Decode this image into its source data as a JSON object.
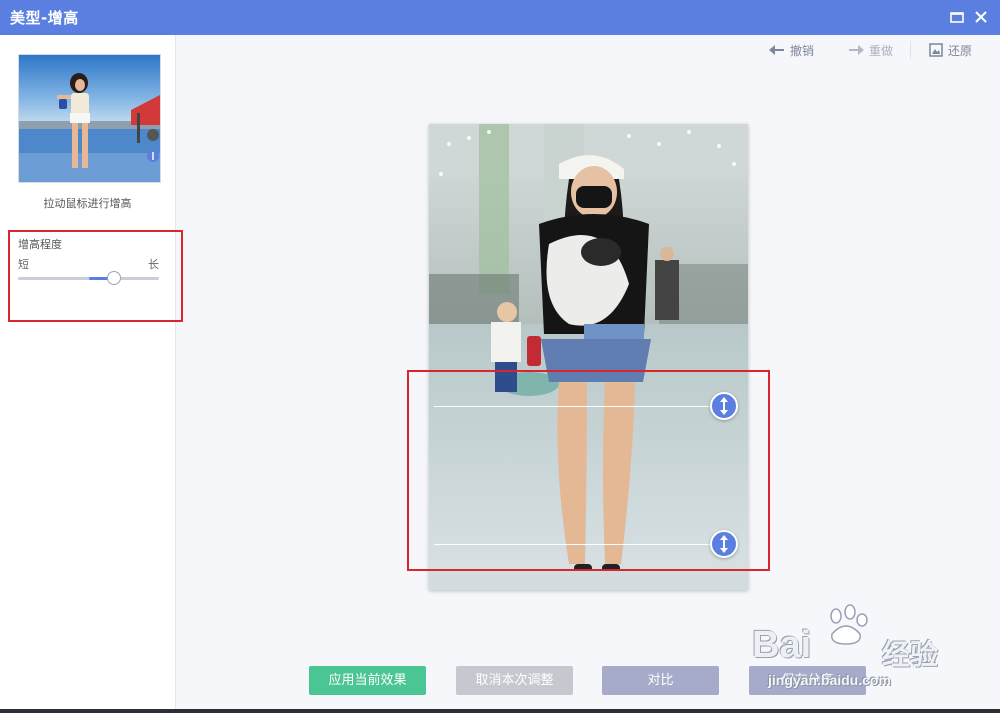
{
  "window": {
    "title": "美型-增高"
  },
  "sidebar": {
    "hint": "拉动鼠标进行增高",
    "slider": {
      "label": "增高程度",
      "min_label": "短",
      "max_label": "长",
      "value": 0.68
    }
  },
  "toolbar": {
    "undo_label": "撤销",
    "redo_label": "重做",
    "restore_label": "还原"
  },
  "actions": {
    "apply_label": "应用当前效果",
    "cancel_label": "取消本次调整",
    "compare_label": "对比",
    "save_label": "保存分享"
  },
  "watermark": {
    "brand": "Bai",
    "brand2": "经验",
    "url": "jingyan.baidu.com"
  },
  "colors": {
    "titlebar": "#5a7fe0",
    "apply": "#4cc594",
    "cancel": "#c5c8cf",
    "compare": "#a6abc9",
    "highlight": "#d9252b"
  }
}
